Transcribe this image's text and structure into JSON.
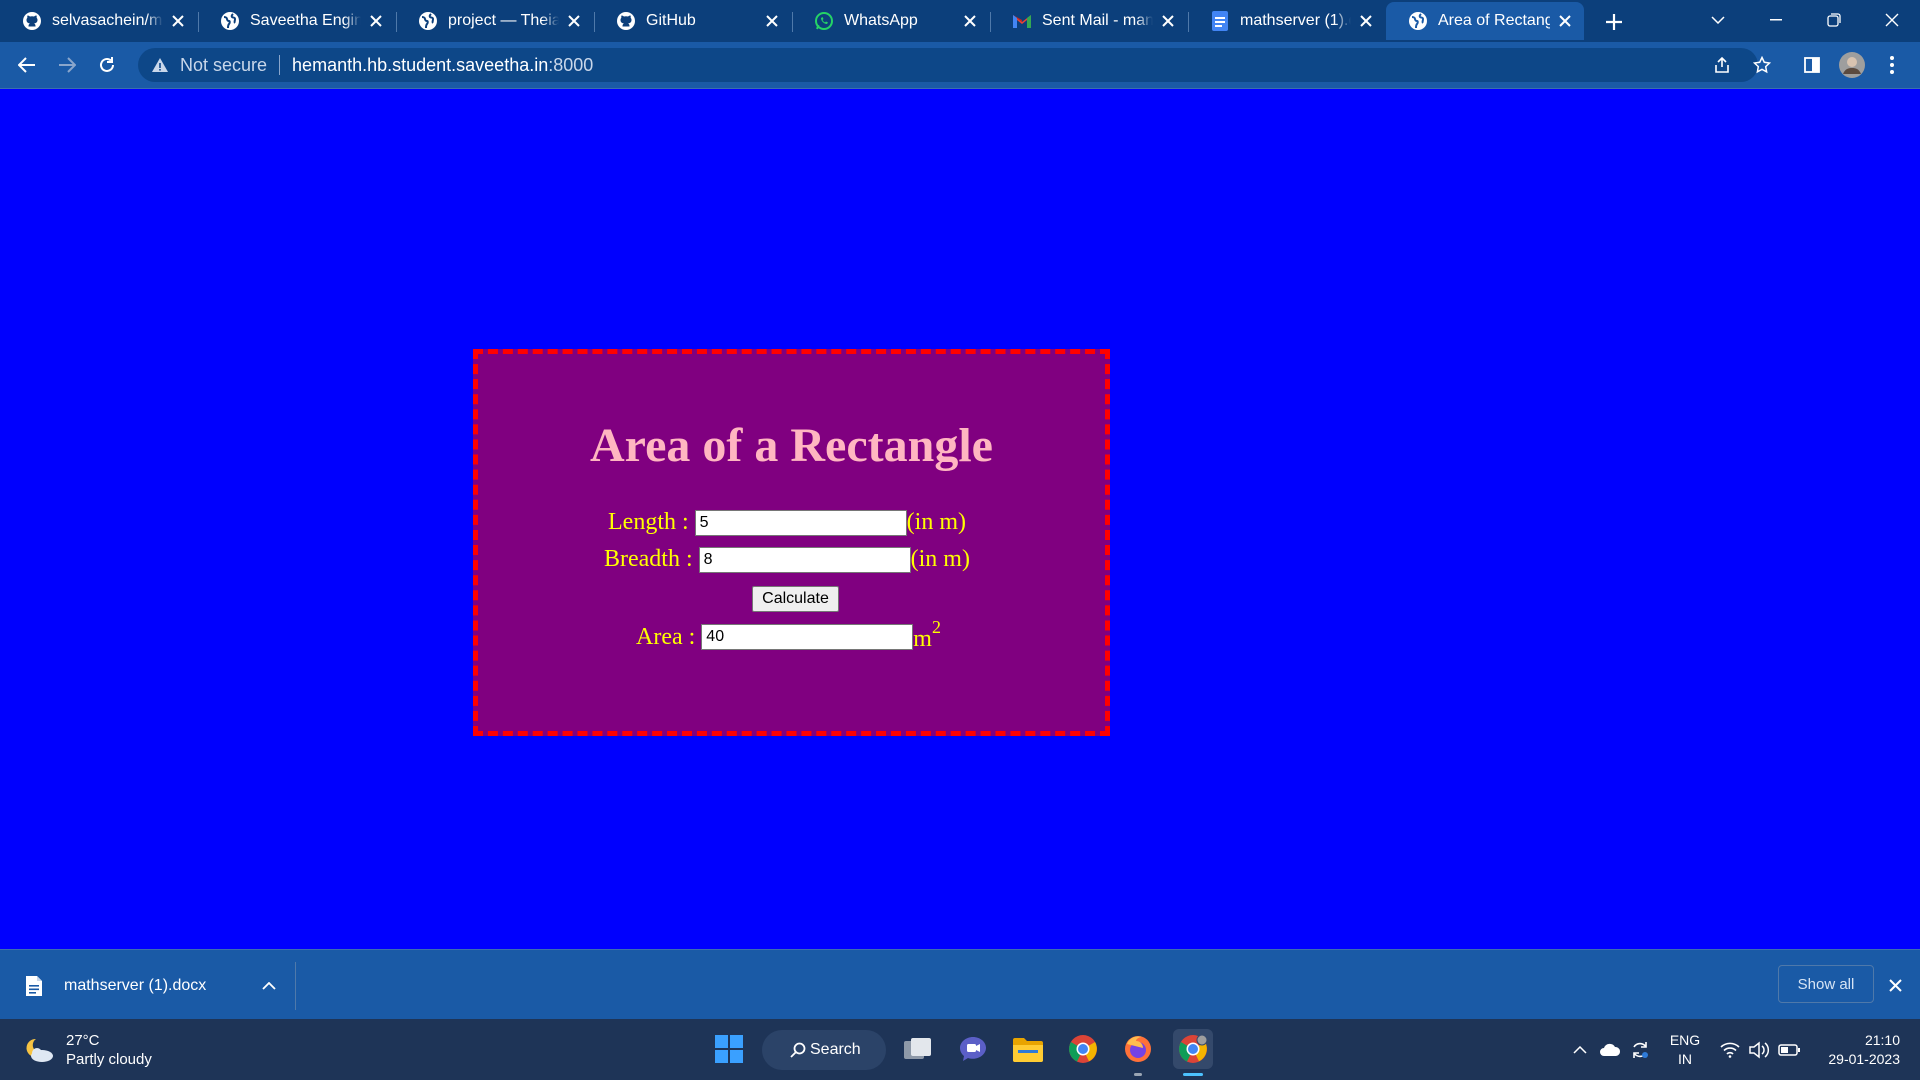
{
  "browser": {
    "tabs": [
      {
        "title": "selvasachein/mat",
        "icon": "github-icon"
      },
      {
        "title": "Saveetha Enginee",
        "icon": "globe-icon"
      },
      {
        "title": "project — Theia",
        "icon": "globe-icon"
      },
      {
        "title": "GitHub",
        "icon": "github-icon"
      },
      {
        "title": "WhatsApp",
        "icon": "whatsapp-icon"
      },
      {
        "title": "Sent Mail - mano",
        "icon": "gmail-icon"
      },
      {
        "title": "mathserver (1).do",
        "icon": "docs-icon"
      },
      {
        "title": "Area of Rectangle",
        "icon": "globe-icon",
        "active": true
      }
    ],
    "address": {
      "security": "Not secure",
      "host": "hemanth.hb.student.saveetha.in",
      "port": ":8000"
    }
  },
  "page": {
    "heading": "Area of a Rectangle",
    "length_label": "Length :",
    "length_value": "5",
    "length_unit": "(in m)",
    "breadth_label": "Breadth :",
    "breadth_value": "8",
    "breadth_unit": "(in m)",
    "calculate_label": "Calculate",
    "area_label": "Area :",
    "area_value": "40",
    "area_unit": "m",
    "area_unit_exp": "2",
    "colors": {
      "background": "#0000fe",
      "box": "#800080",
      "border": "#ff0000",
      "heading": "#ffb6c1",
      "label": "#ffff00"
    }
  },
  "downloads": {
    "file_name": "mathserver (1).docx",
    "show_all": "Show all"
  },
  "taskbar": {
    "temperature": "27°C",
    "condition": "Partly cloudy",
    "search_label": "Search",
    "language": "ENG",
    "region": "IN",
    "time": "21:10",
    "date": "29-01-2023"
  }
}
